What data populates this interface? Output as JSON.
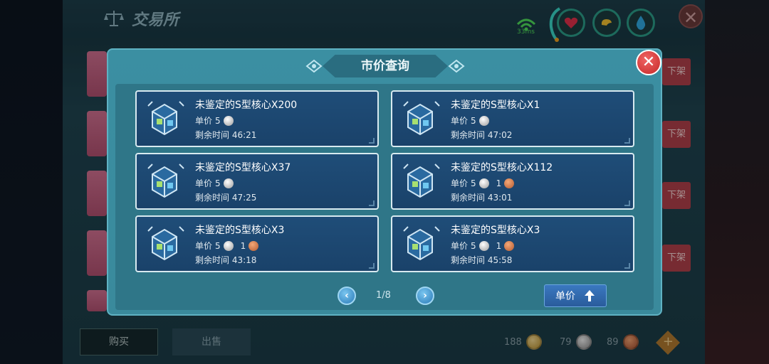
{
  "background": {
    "title": "交易所",
    "ping": "33ms",
    "xiajia_label": "下架",
    "buy_tab": "购买",
    "sell_tab": "出售",
    "currency": [
      {
        "amount": "188",
        "type": "gold"
      },
      {
        "amount": "79",
        "type": "silver"
      },
      {
        "amount": "89",
        "type": "bronze"
      }
    ]
  },
  "modal": {
    "title": "市价查询",
    "price_label": "单价",
    "time_label": "剩余时间",
    "items": [
      {
        "name": "未鉴定的S型核心X200",
        "silver": "5",
        "bronze": "",
        "time": "46:21"
      },
      {
        "name": "未鉴定的S型核心X1",
        "silver": "5",
        "bronze": "",
        "time": "47:02"
      },
      {
        "name": "未鉴定的S型核心X37",
        "silver": "5",
        "bronze": "",
        "time": "47:25"
      },
      {
        "name": "未鉴定的S型核心X112",
        "silver": "5",
        "bronze": "1",
        "time": "43:01"
      },
      {
        "name": "未鉴定的S型核心X3",
        "silver": "5",
        "bronze": "1",
        "time": "43:18"
      },
      {
        "name": "未鉴定的S型核心X3",
        "silver": "5",
        "bronze": "1",
        "time": "45:58"
      }
    ],
    "page": "1/8",
    "sort_label": "单价"
  },
  "colors": {
    "modal_bg": "#3a8a9c",
    "card_bg": "#1f4d78",
    "close_red": "#c62828",
    "sort_blue": "#3a78c0"
  }
}
